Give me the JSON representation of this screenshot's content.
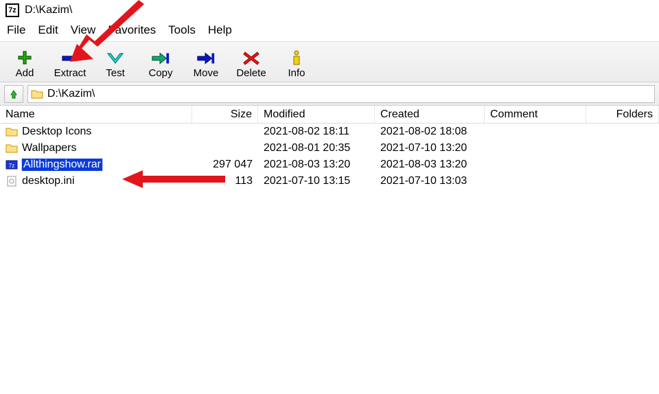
{
  "title": "D:\\Kazim\\",
  "menu": {
    "file": "File",
    "edit": "Edit",
    "view": "View",
    "favorites": "Favorites",
    "tools": "Tools",
    "help": "Help"
  },
  "toolbar": {
    "add": "Add",
    "extract": "Extract",
    "test": "Test",
    "copy": "Copy",
    "move": "Move",
    "delete": "Delete",
    "info": "Info"
  },
  "path": "D:\\Kazim\\",
  "columns": {
    "name": "Name",
    "size": "Size",
    "modified": "Modified",
    "created": "Created",
    "comment": "Comment",
    "folders": "Folders"
  },
  "rows": [
    {
      "icon": "folder",
      "name": "Desktop Icons",
      "size": "",
      "modified": "2021-08-02 18:11",
      "created": "2021-08-02 18:08",
      "selected": false
    },
    {
      "icon": "folder",
      "name": "Wallpapers",
      "size": "",
      "modified": "2021-08-01 20:35",
      "created": "2021-07-10 13:20",
      "selected": false
    },
    {
      "icon": "archive",
      "name": "Allthingshow.rar",
      "size": "297 047",
      "modified": "2021-08-03 13:20",
      "created": "2021-08-03 13:20",
      "selected": true
    },
    {
      "icon": "ini",
      "name": "desktop.ini",
      "size": "113",
      "modified": "2021-07-10 13:15",
      "created": "2021-07-10 13:03",
      "selected": false
    }
  ]
}
